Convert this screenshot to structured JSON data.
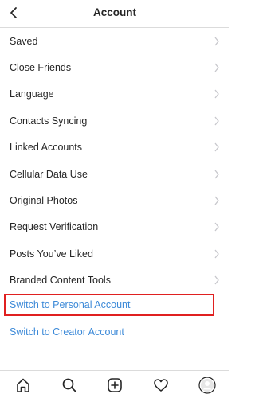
{
  "header": {
    "title": "Account",
    "back_icon": "chevron-left-icon"
  },
  "menu": {
    "items": [
      {
        "label": "Saved"
      },
      {
        "label": "Close Friends"
      },
      {
        "label": "Language"
      },
      {
        "label": "Contacts Syncing"
      },
      {
        "label": "Linked Accounts"
      },
      {
        "label": "Cellular Data Use"
      },
      {
        "label": "Original Photos"
      },
      {
        "label": "Request Verification"
      },
      {
        "label": "Posts You’ve Liked"
      },
      {
        "label": "Branded Content Tools"
      }
    ]
  },
  "links": {
    "personal": "Switch to Personal Account",
    "creator": "Switch to Creator Account"
  },
  "colors": {
    "link": "#3d8ad8",
    "highlight": "#e02020",
    "divider": "#dbdbdb"
  },
  "tabbar": {
    "icons": [
      "home-icon",
      "search-icon",
      "add-post-icon",
      "heart-icon",
      "profile-icon"
    ]
  }
}
